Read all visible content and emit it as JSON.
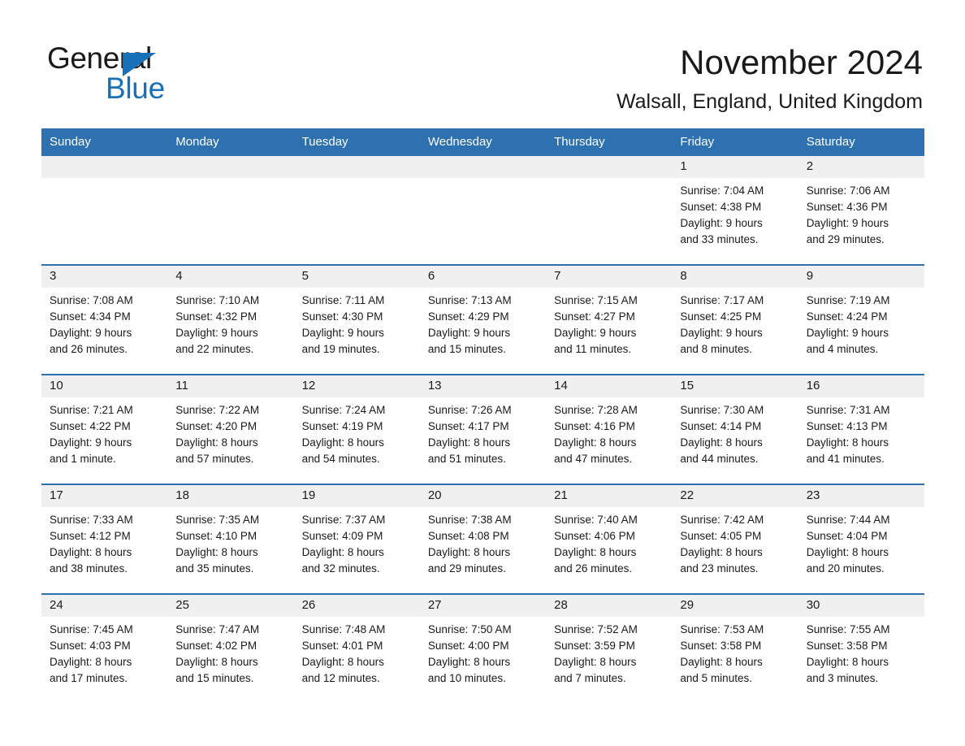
{
  "brand": {
    "name_part1": "General",
    "name_part2": "Blue",
    "accent_color": "#1871b8",
    "triangle_icon": "triangle-icon"
  },
  "header": {
    "month_title": "November 2024",
    "location": "Walsall, England, United Kingdom"
  },
  "theme": {
    "header_blue": "#2e71b0",
    "date_band_gray": "#f0f0f0",
    "text_color": "#1a1a1a"
  },
  "calendar": {
    "weekday_headers": [
      "Sunday",
      "Monday",
      "Tuesday",
      "Wednesday",
      "Thursday",
      "Friday",
      "Saturday"
    ],
    "labels": {
      "sunrise_prefix": "Sunrise:",
      "sunset_prefix": "Sunset:",
      "daylight_prefix": "Daylight:"
    },
    "weeks": [
      [
        {
          "day": "",
          "empty": true
        },
        {
          "day": "",
          "empty": true
        },
        {
          "day": "",
          "empty": true
        },
        {
          "day": "",
          "empty": true
        },
        {
          "day": "",
          "empty": true
        },
        {
          "day": "1",
          "sunrise": "Sunrise: 7:04 AM",
          "sunset": "Sunset: 4:38 PM",
          "daylight_line1": "Daylight: 9 hours",
          "daylight_line2": "and 33 minutes."
        },
        {
          "day": "2",
          "sunrise": "Sunrise: 7:06 AM",
          "sunset": "Sunset: 4:36 PM",
          "daylight_line1": "Daylight: 9 hours",
          "daylight_line2": "and 29 minutes."
        }
      ],
      [
        {
          "day": "3",
          "sunrise": "Sunrise: 7:08 AM",
          "sunset": "Sunset: 4:34 PM",
          "daylight_line1": "Daylight: 9 hours",
          "daylight_line2": "and 26 minutes."
        },
        {
          "day": "4",
          "sunrise": "Sunrise: 7:10 AM",
          "sunset": "Sunset: 4:32 PM",
          "daylight_line1": "Daylight: 9 hours",
          "daylight_line2": "and 22 minutes."
        },
        {
          "day": "5",
          "sunrise": "Sunrise: 7:11 AM",
          "sunset": "Sunset: 4:30 PM",
          "daylight_line1": "Daylight: 9 hours",
          "daylight_line2": "and 19 minutes."
        },
        {
          "day": "6",
          "sunrise": "Sunrise: 7:13 AM",
          "sunset": "Sunset: 4:29 PM",
          "daylight_line1": "Daylight: 9 hours",
          "daylight_line2": "and 15 minutes."
        },
        {
          "day": "7",
          "sunrise": "Sunrise: 7:15 AM",
          "sunset": "Sunset: 4:27 PM",
          "daylight_line1": "Daylight: 9 hours",
          "daylight_line2": "and 11 minutes."
        },
        {
          "day": "8",
          "sunrise": "Sunrise: 7:17 AM",
          "sunset": "Sunset: 4:25 PM",
          "daylight_line1": "Daylight: 9 hours",
          "daylight_line2": "and 8 minutes."
        },
        {
          "day": "9",
          "sunrise": "Sunrise: 7:19 AM",
          "sunset": "Sunset: 4:24 PM",
          "daylight_line1": "Daylight: 9 hours",
          "daylight_line2": "and 4 minutes."
        }
      ],
      [
        {
          "day": "10",
          "sunrise": "Sunrise: 7:21 AM",
          "sunset": "Sunset: 4:22 PM",
          "daylight_line1": "Daylight: 9 hours",
          "daylight_line2": "and 1 minute."
        },
        {
          "day": "11",
          "sunrise": "Sunrise: 7:22 AM",
          "sunset": "Sunset: 4:20 PM",
          "daylight_line1": "Daylight: 8 hours",
          "daylight_line2": "and 57 minutes."
        },
        {
          "day": "12",
          "sunrise": "Sunrise: 7:24 AM",
          "sunset": "Sunset: 4:19 PM",
          "daylight_line1": "Daylight: 8 hours",
          "daylight_line2": "and 54 minutes."
        },
        {
          "day": "13",
          "sunrise": "Sunrise: 7:26 AM",
          "sunset": "Sunset: 4:17 PM",
          "daylight_line1": "Daylight: 8 hours",
          "daylight_line2": "and 51 minutes."
        },
        {
          "day": "14",
          "sunrise": "Sunrise: 7:28 AM",
          "sunset": "Sunset: 4:16 PM",
          "daylight_line1": "Daylight: 8 hours",
          "daylight_line2": "and 47 minutes."
        },
        {
          "day": "15",
          "sunrise": "Sunrise: 7:30 AM",
          "sunset": "Sunset: 4:14 PM",
          "daylight_line1": "Daylight: 8 hours",
          "daylight_line2": "and 44 minutes."
        },
        {
          "day": "16",
          "sunrise": "Sunrise: 7:31 AM",
          "sunset": "Sunset: 4:13 PM",
          "daylight_line1": "Daylight: 8 hours",
          "daylight_line2": "and 41 minutes."
        }
      ],
      [
        {
          "day": "17",
          "sunrise": "Sunrise: 7:33 AM",
          "sunset": "Sunset: 4:12 PM",
          "daylight_line1": "Daylight: 8 hours",
          "daylight_line2": "and 38 minutes."
        },
        {
          "day": "18",
          "sunrise": "Sunrise: 7:35 AM",
          "sunset": "Sunset: 4:10 PM",
          "daylight_line1": "Daylight: 8 hours",
          "daylight_line2": "and 35 minutes."
        },
        {
          "day": "19",
          "sunrise": "Sunrise: 7:37 AM",
          "sunset": "Sunset: 4:09 PM",
          "daylight_line1": "Daylight: 8 hours",
          "daylight_line2": "and 32 minutes."
        },
        {
          "day": "20",
          "sunrise": "Sunrise: 7:38 AM",
          "sunset": "Sunset: 4:08 PM",
          "daylight_line1": "Daylight: 8 hours",
          "daylight_line2": "and 29 minutes."
        },
        {
          "day": "21",
          "sunrise": "Sunrise: 7:40 AM",
          "sunset": "Sunset: 4:06 PM",
          "daylight_line1": "Daylight: 8 hours",
          "daylight_line2": "and 26 minutes."
        },
        {
          "day": "22",
          "sunrise": "Sunrise: 7:42 AM",
          "sunset": "Sunset: 4:05 PM",
          "daylight_line1": "Daylight: 8 hours",
          "daylight_line2": "and 23 minutes."
        },
        {
          "day": "23",
          "sunrise": "Sunrise: 7:44 AM",
          "sunset": "Sunset: 4:04 PM",
          "daylight_line1": "Daylight: 8 hours",
          "daylight_line2": "and 20 minutes."
        }
      ],
      [
        {
          "day": "24",
          "sunrise": "Sunrise: 7:45 AM",
          "sunset": "Sunset: 4:03 PM",
          "daylight_line1": "Daylight: 8 hours",
          "daylight_line2": "and 17 minutes."
        },
        {
          "day": "25",
          "sunrise": "Sunrise: 7:47 AM",
          "sunset": "Sunset: 4:02 PM",
          "daylight_line1": "Daylight: 8 hours",
          "daylight_line2": "and 15 minutes."
        },
        {
          "day": "26",
          "sunrise": "Sunrise: 7:48 AM",
          "sunset": "Sunset: 4:01 PM",
          "daylight_line1": "Daylight: 8 hours",
          "daylight_line2": "and 12 minutes."
        },
        {
          "day": "27",
          "sunrise": "Sunrise: 7:50 AM",
          "sunset": "Sunset: 4:00 PM",
          "daylight_line1": "Daylight: 8 hours",
          "daylight_line2": "and 10 minutes."
        },
        {
          "day": "28",
          "sunrise": "Sunrise: 7:52 AM",
          "sunset": "Sunset: 3:59 PM",
          "daylight_line1": "Daylight: 8 hours",
          "daylight_line2": "and 7 minutes."
        },
        {
          "day": "29",
          "sunrise": "Sunrise: 7:53 AM",
          "sunset": "Sunset: 3:58 PM",
          "daylight_line1": "Daylight: 8 hours",
          "daylight_line2": "and 5 minutes."
        },
        {
          "day": "30",
          "sunrise": "Sunrise: 7:55 AM",
          "sunset": "Sunset: 3:58 PM",
          "daylight_line1": "Daylight: 8 hours",
          "daylight_line2": "and 3 minutes."
        }
      ]
    ]
  }
}
